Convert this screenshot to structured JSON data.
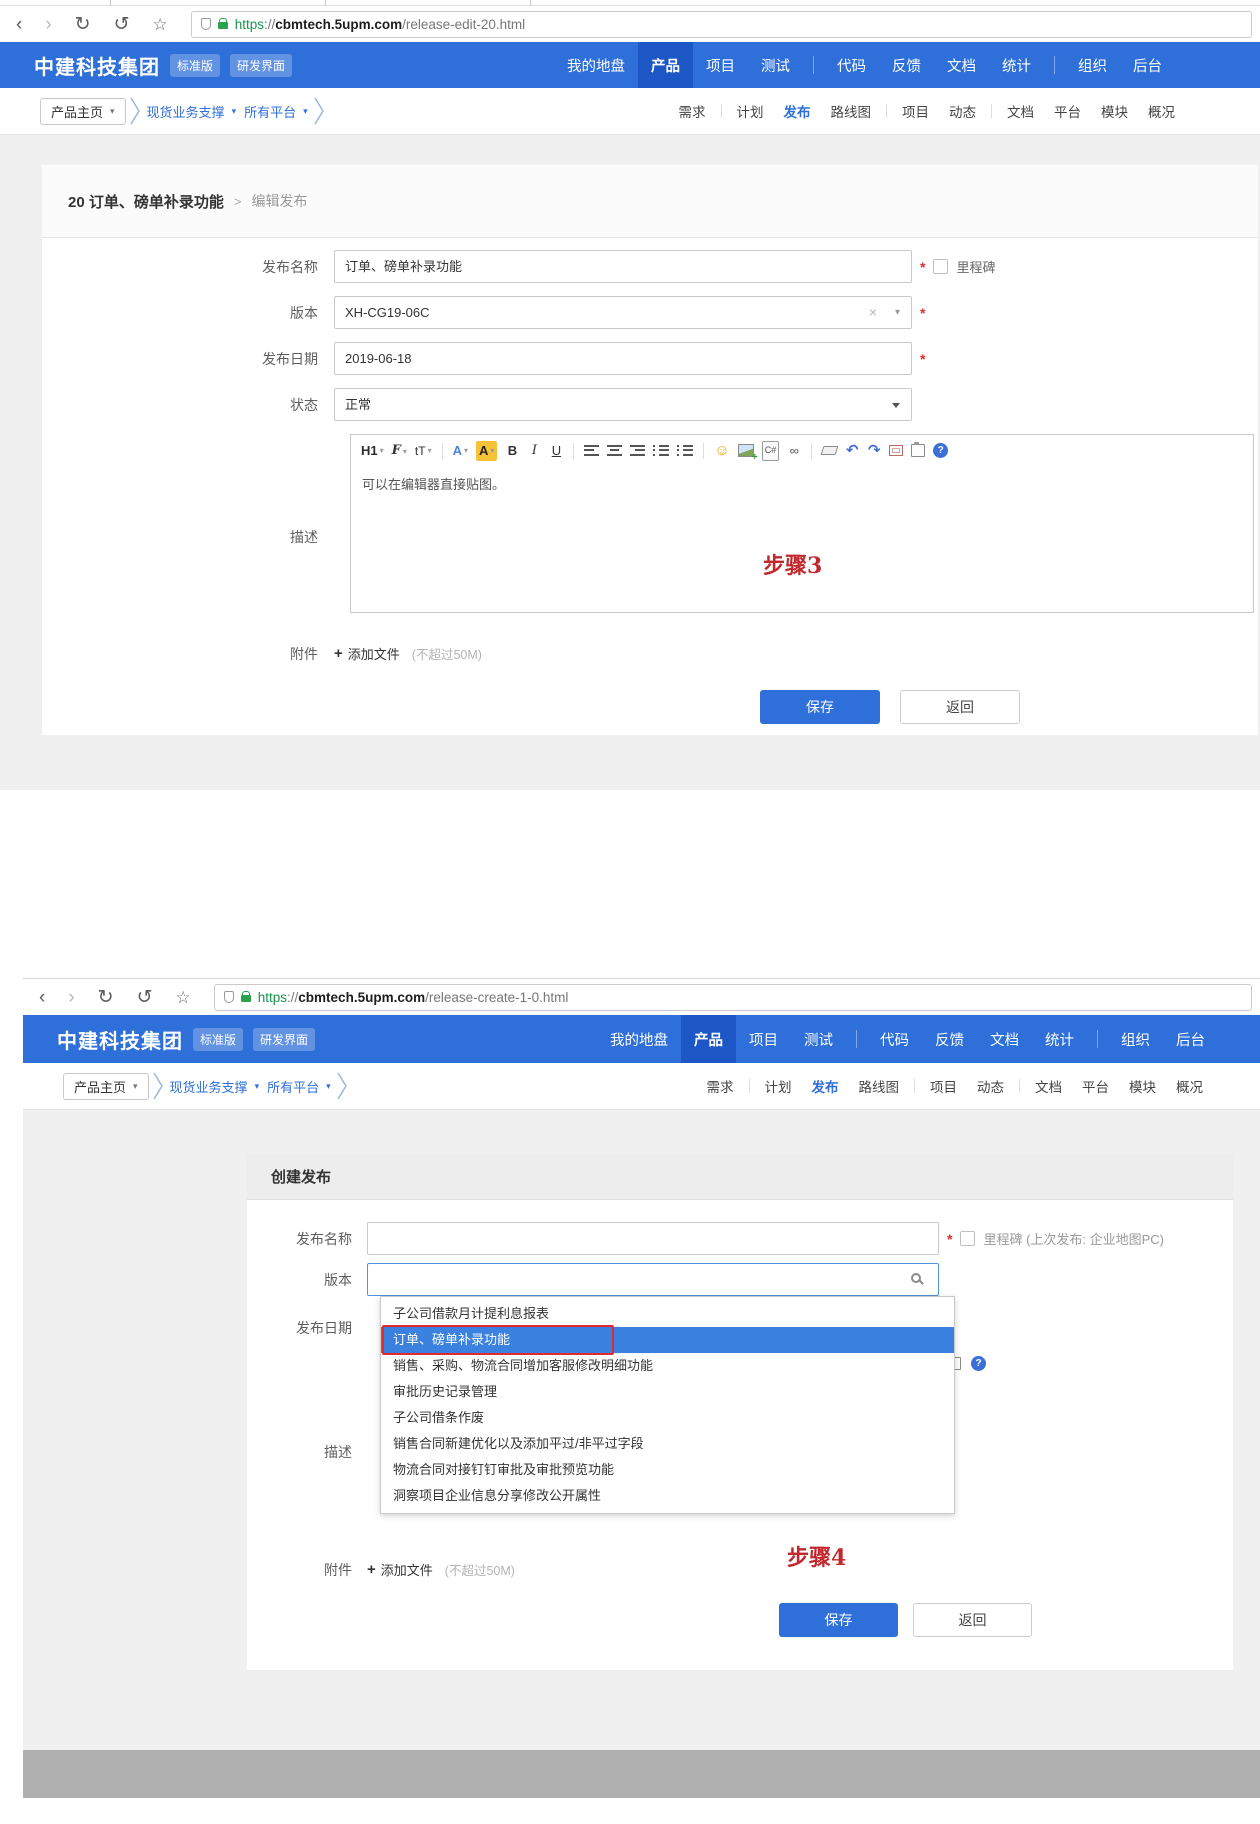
{
  "shared": {
    "brand": "中建科技集团",
    "badges": [
      "标准版",
      "研发界面"
    ],
    "browser": {
      "protocol": "https",
      "sep": "://",
      "host": "cbmtech.5upm.com"
    },
    "icons": {
      "back": "‹",
      "forward": "›",
      "reload": "↻",
      "history": "↺",
      "star": "☆",
      "close": "×",
      "caret": "▾",
      "plus": "+",
      "help": "?"
    },
    "topnav": [
      [
        {
          "label": "我的地盘"
        },
        {
          "label": "产品",
          "cls": "active"
        },
        {
          "label": "项目"
        },
        {
          "label": "测试"
        }
      ],
      [
        {
          "label": "代码"
        },
        {
          "label": "反馈"
        },
        {
          "label": "文档"
        },
        {
          "label": "统计"
        }
      ],
      [
        {
          "label": "组织"
        },
        {
          "label": "后台"
        }
      ]
    ],
    "subnav": [
      [
        {
          "label": "需求"
        }
      ],
      [
        {
          "label": "计划"
        },
        {
          "label": "发布",
          "cls": "active"
        },
        {
          "label": "路线图"
        }
      ],
      [
        {
          "label": "项目"
        },
        {
          "label": "动态"
        }
      ],
      [
        {
          "label": "文档"
        },
        {
          "label": "平台"
        },
        {
          "label": "模块"
        },
        {
          "label": "概况"
        }
      ]
    ],
    "crumb": {
      "home": "产品主页",
      "product": "现货业务支撑",
      "platform": "所有平台"
    }
  },
  "s1": {
    "url_path": "/release-edit-20.html",
    "title": "20 订单、磅单补录功能",
    "title_sep": ">",
    "subtitle": "编辑发布",
    "required": "*",
    "milestone": "里程碑",
    "fields": {
      "name": {
        "label": "发布名称",
        "value": "订单、磅单补录功能"
      },
      "build": {
        "label": "版本",
        "value": "XH-CG19-06C"
      },
      "date": {
        "label": "发布日期",
        "value": "2019-06-18"
      },
      "status": {
        "label": "状态",
        "value": "正常"
      }
    },
    "desc_label": "描述",
    "desc_text": "可以在编辑器直接贴图。",
    "tools": [
      {
        "name": "heading",
        "glyph": "H1",
        "cls": "t-h1 caret"
      },
      {
        "name": "font-family",
        "glyph": "F",
        "cls": "t-font caret"
      },
      {
        "name": "font-size",
        "glyph": "tT",
        "cls": "t-size caret"
      },
      {
        "cls": "sep"
      },
      {
        "name": "font-color",
        "glyph": "A",
        "cls": "t-colA caret"
      },
      {
        "name": "highlight-color",
        "glyph": "A",
        "cls": "t-bgA caret"
      },
      {
        "name": "bold",
        "glyph": "B",
        "cls": "t-b"
      },
      {
        "name": "italic",
        "glyph": "I",
        "cls": "t-i"
      },
      {
        "name": "underline",
        "glyph": "U",
        "cls": "t-u"
      },
      {
        "cls": "sep"
      },
      {
        "name": "align-left",
        "cls": "bars b-left"
      },
      {
        "name": "align-center",
        "cls": "bars b-center"
      },
      {
        "name": "align-right",
        "cls": "bars b-right"
      },
      {
        "name": "ordered-list",
        "cls": "bars b-ol"
      },
      {
        "name": "unordered-list",
        "cls": "bars b-ul"
      },
      {
        "cls": "sep"
      },
      {
        "name": "emoticon",
        "glyph": "☺",
        "cls": "t-smile"
      },
      {
        "name": "insert-image",
        "cls": "t-img"
      },
      {
        "name": "insert-code",
        "glyph": "C#",
        "cls": "t-code"
      },
      {
        "name": "insert-link",
        "glyph": "∞",
        "cls": "t-link"
      },
      {
        "cls": "sep"
      },
      {
        "name": "eraser",
        "cls": "t-eraser"
      },
      {
        "name": "undo",
        "glyph": "↶",
        "cls": "t-undo"
      },
      {
        "name": "redo",
        "glyph": "↷",
        "cls": "t-redo"
      },
      {
        "name": "fullscreen",
        "cls": "t-fs"
      },
      {
        "name": "paste",
        "cls": "t-clip"
      },
      {
        "name": "editor-help",
        "glyph": "?",
        "cls": "t-help"
      }
    ],
    "files": {
      "label": "附件",
      "add": "添加文件",
      "hint": "(不超过50M)"
    },
    "annotation": "步骤3",
    "buttons": {
      "save": "保存",
      "back": "返回"
    }
  },
  "s2": {
    "url_path": "/release-create-1-0.html",
    "heading": "创建发布",
    "required": "*",
    "milestone": "里程碑 (上次发布: 企业地图PC)",
    "fields": {
      "name_label": "发布名称",
      "build_label": "版本",
      "date_label": "发布日期"
    },
    "desc_label": "描述",
    "dropdown": [
      {
        "label": "子公司借款月计提利息报表"
      },
      {
        "label": "订单、磅单补录功能",
        "cls": "sel"
      },
      {
        "label": "销售、采购、物流合同增加客服修改明细功能"
      },
      {
        "label": "审批历史记录管理"
      },
      {
        "label": "子公司借条作废"
      },
      {
        "label": "销售合同新建优化以及添加平过/非平过字段"
      },
      {
        "label": "物流合同对接钉钉审批及审批预览功能"
      },
      {
        "label": "洞察项目企业信息分享修改公开属性"
      }
    ],
    "files": {
      "label": "附件",
      "add": "添加文件",
      "hint": "(不超过50M)"
    },
    "annotation": "步骤4",
    "buttons": {
      "save": "保存",
      "back": "返回"
    }
  }
}
